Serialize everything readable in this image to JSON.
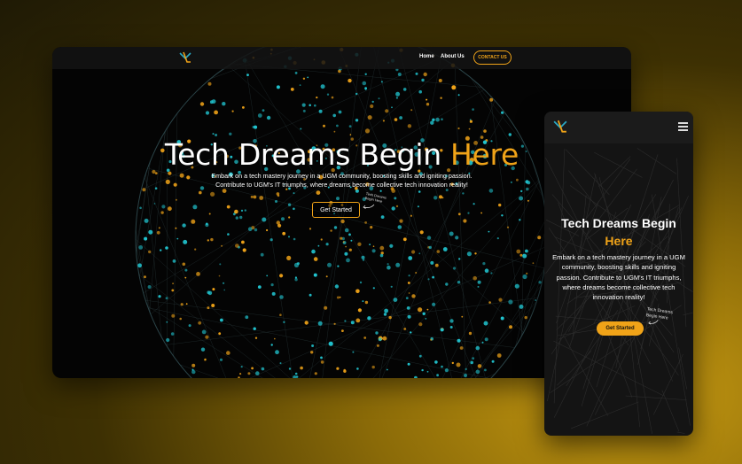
{
  "desktop": {
    "nav": {
      "links": [
        "Home",
        "About Us"
      ],
      "contact_label": "CONTACT US"
    },
    "hero": {
      "title_main": "Tech Dreams Begin ",
      "title_accent": "Here",
      "subtitle_line1": "Embark on a tech mastery journey in a UGM community, boosting skills and igniting passion.",
      "subtitle_line2": "Contribute to UGM's IT triumphs, where dreams become collective tech innovation reality!",
      "cta_label": "Get Started",
      "note": "Tech Dreams Begin Here"
    }
  },
  "mobile": {
    "hero": {
      "title_main": "Tech Dreams Begin",
      "title_accent": "Here",
      "subtitle": "Embark on a tech mastery journey in a UGM community, boosting skills and igniting passion.  Contribute to UGM's IT triumphs, where dreams become collective tech innovation reality!",
      "cta_label": "Get Started",
      "note": "Tech Dreams Begin Here"
    }
  },
  "colors": {
    "accent": "#f0a318",
    "teal": "#21c4cf",
    "background": "#040404"
  },
  "icons": [
    "logo-icon",
    "hamburger-menu-icon",
    "arrow-icon"
  ]
}
